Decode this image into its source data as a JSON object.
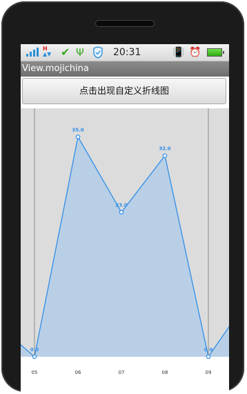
{
  "status_bar": {
    "network_label": "H",
    "time": "20:31"
  },
  "app": {
    "title": "View.mojichina"
  },
  "button": {
    "label": "点击出现自定义折线图"
  },
  "chart_data": {
    "type": "area",
    "categories": [
      "05",
      "06",
      "07",
      "08",
      "09"
    ],
    "values": [
      0.0,
      35.0,
      23.0,
      32.0,
      0.0
    ],
    "data_labels": [
      "0.0",
      "35.0",
      "23.0",
      "32.0",
      "0.0"
    ],
    "edge_values_offscreen": [
      6.0,
      10.0
    ],
    "ylim": [
      0,
      38
    ],
    "grid": false,
    "colors": {
      "line": "#2f8de6",
      "fill": "#b9cfe6",
      "background": "#dcdcdc",
      "label": "#2f8de6"
    }
  }
}
